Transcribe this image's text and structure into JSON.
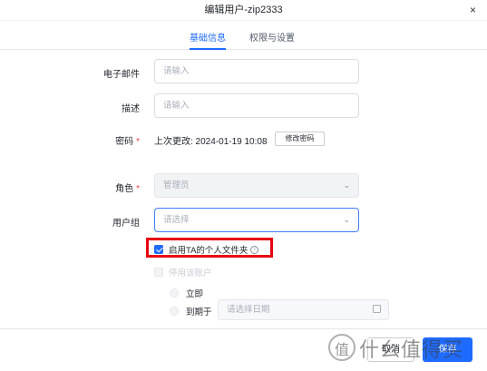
{
  "dialog": {
    "title": "编辑用户-zip2333",
    "close_icon": "×"
  },
  "tabs": [
    {
      "label": "基础信息",
      "active": true
    },
    {
      "label": "权限与设置",
      "active": false
    }
  ],
  "form": {
    "email": {
      "label": "电子邮件",
      "placeholder": "请输入"
    },
    "description": {
      "label": "描述",
      "placeholder": "请输入"
    },
    "password": {
      "label": "密码",
      "required_mark": "*",
      "last_changed": "上次更改: 2024-01-19 10:08",
      "change_button": "修改密码"
    },
    "role": {
      "label": "角色",
      "required_mark": "*",
      "value": "管理员",
      "disabled": true
    },
    "user_group": {
      "label": "用户组",
      "placeholder": "请选择"
    },
    "enable_personal_folder": {
      "label": "启用TA的个人文件夹",
      "checked": true,
      "info_icon": "i"
    },
    "disable_account": {
      "label": "停用该账户",
      "checked": false,
      "disabled": true
    },
    "disable_options": [
      {
        "label": "立即"
      },
      {
        "label": "到期于",
        "date_placeholder": "请选择日期"
      }
    ]
  },
  "footer": {
    "cancel_label": "取消",
    "save_label": "保存"
  },
  "watermark": {
    "text": "什么值得买"
  },
  "colors": {
    "accent": "#1f6bff",
    "highlight_box": "#e60012",
    "required": "#f53f3f"
  }
}
